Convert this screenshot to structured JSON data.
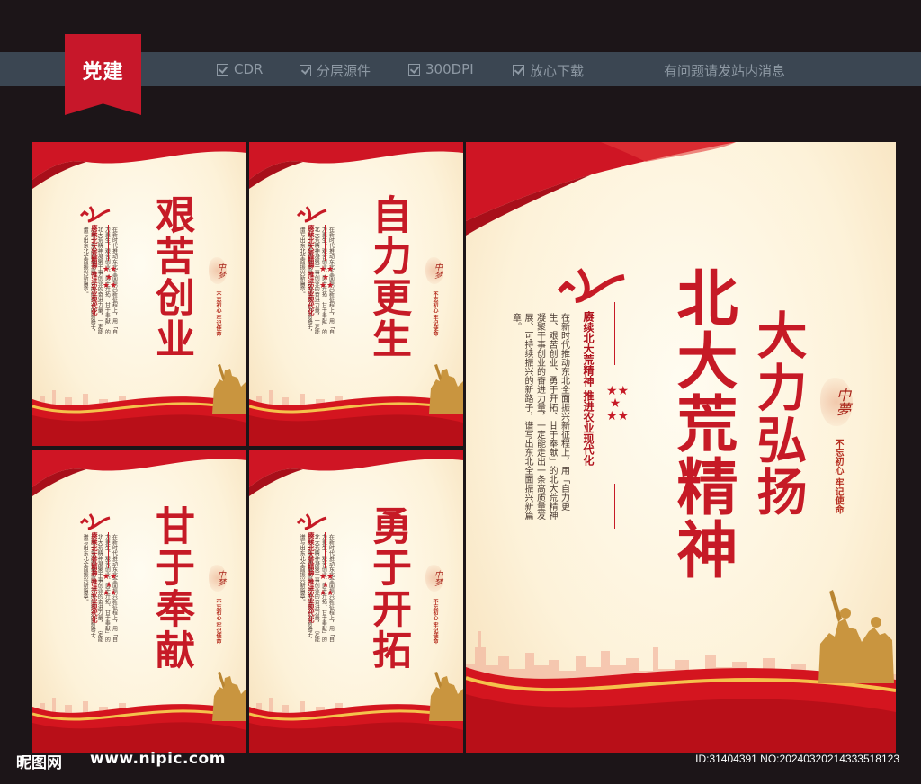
{
  "header": {
    "badge": "党建",
    "features": [
      "CDR",
      "分层源件",
      "300DPI",
      "放心下载"
    ],
    "notice": "有问题请发站内消息"
  },
  "posters": [
    {
      "title": "艰苦创业",
      "subtitle": "赓续北大荒精神 推进农业现代化",
      "seal": "不忘初心 牢记使命",
      "stamp": "中梦"
    },
    {
      "title": "自力更生",
      "subtitle": "赓续北大荒精神 推进农业现代化",
      "seal": "不忘初心 牢记使命",
      "stamp": "中梦"
    },
    {
      "title": "甘于奉献",
      "subtitle": "赓续北大荒精神 推进农业现代化",
      "seal": "不忘初心 牢记使命",
      "stamp": "中梦"
    },
    {
      "title": "勇于开拓",
      "subtitle": "赓续北大荒精神 推进农业现代化",
      "seal": "不忘初心 牢记使命",
      "stamp": "中梦"
    }
  ],
  "main_poster": {
    "title_right": "大力弘扬",
    "title_left": "北大荒精神",
    "subtitle": "赓续北大荒精神 推进农业现代化",
    "body": "在新时代推动东北全面振兴新征程上，用「自力更生、艰苦创业、勇于开拓、甘于奉献」的北大荒精神凝聚干事创业的奋进力量，一定能走出一条高质量发展、可持续振兴的新路子，谱写出东北全面振兴新篇章。",
    "seal": "不忘初心 牢记使命",
    "stamp": "中夢"
  },
  "footer": {
    "logo": "昵图网",
    "url": "www.nipic.com",
    "id": "ID:31404391 NO:20240320214333518123"
  },
  "colors": {
    "red": "#c61a26",
    "badge": "#c7172a",
    "bar": "#3b4652",
    "bg": "#1c1518"
  }
}
